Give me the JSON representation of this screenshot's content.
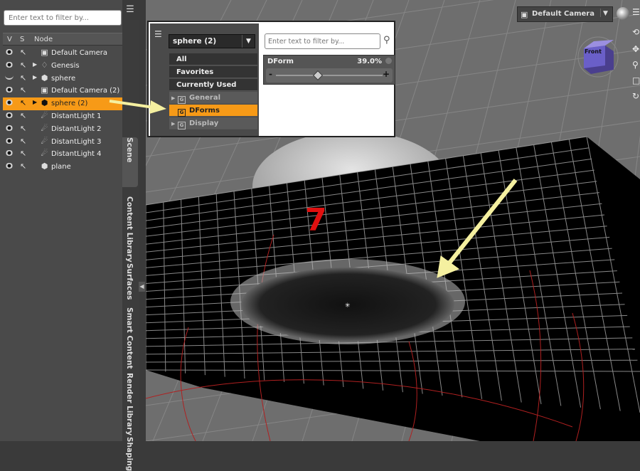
{
  "scene": {
    "filter_placeholder": "Enter text to filter by...",
    "columns": {
      "v": "V",
      "s": "S",
      "node": "Node"
    },
    "nodes": [
      {
        "label": "Default Camera",
        "icon": "camera-icon",
        "visible": true,
        "expandable": false,
        "selected": false
      },
      {
        "label": "Genesis",
        "icon": "figure-icon",
        "visible": true,
        "expandable": true,
        "selected": false
      },
      {
        "label": "sphere",
        "icon": "primitive-icon",
        "visible": false,
        "expandable": true,
        "selected": false
      },
      {
        "label": "Default Camera (2)",
        "icon": "camera-icon",
        "visible": true,
        "expandable": false,
        "selected": false
      },
      {
        "label": "sphere (2)",
        "icon": "primitive-icon",
        "visible": true,
        "expandable": true,
        "selected": true
      },
      {
        "label": "DistantLight 1",
        "icon": "light-icon",
        "visible": true,
        "expandable": false,
        "selected": false
      },
      {
        "label": "DistantLight 2",
        "icon": "light-icon",
        "visible": true,
        "expandable": false,
        "selected": false
      },
      {
        "label": "DistantLight 3",
        "icon": "light-icon",
        "visible": true,
        "expandable": false,
        "selected": false
      },
      {
        "label": "DistantLight 4",
        "icon": "light-icon",
        "visible": true,
        "expandable": false,
        "selected": false
      },
      {
        "label": "plane",
        "icon": "primitive-icon",
        "visible": true,
        "expandable": false,
        "selected": false
      }
    ]
  },
  "tabs": [
    "Scene",
    "Content Library",
    "Surfaces",
    "Smart Content",
    "Render Library",
    "Shaping"
  ],
  "viewport": {
    "camera_label": "Default Camera",
    "cube_face": "Front",
    "step_number": "7"
  },
  "parameters": {
    "node_selected": "sphere (2)",
    "categories": [
      {
        "label": "All",
        "kind": "top"
      },
      {
        "label": "Favorites",
        "kind": "top"
      },
      {
        "label": "Currently Used",
        "kind": "top"
      },
      {
        "label": "General",
        "kind": "group",
        "expandable": true,
        "selected": false
      },
      {
        "label": "DForms",
        "kind": "group",
        "expandable": false,
        "selected": true
      },
      {
        "label": "Display",
        "kind": "group",
        "expandable": true,
        "selected": false
      }
    ],
    "filter_placeholder": "Enter text to filter by...",
    "param": {
      "name": "DForm",
      "value_text": "39.0%",
      "value": 0.39,
      "minus": "-",
      "plus": "+"
    }
  },
  "colors": {
    "selection": "#f79a17",
    "annotation_arrow": "#f5f0a0",
    "step_number": "#e01010"
  }
}
